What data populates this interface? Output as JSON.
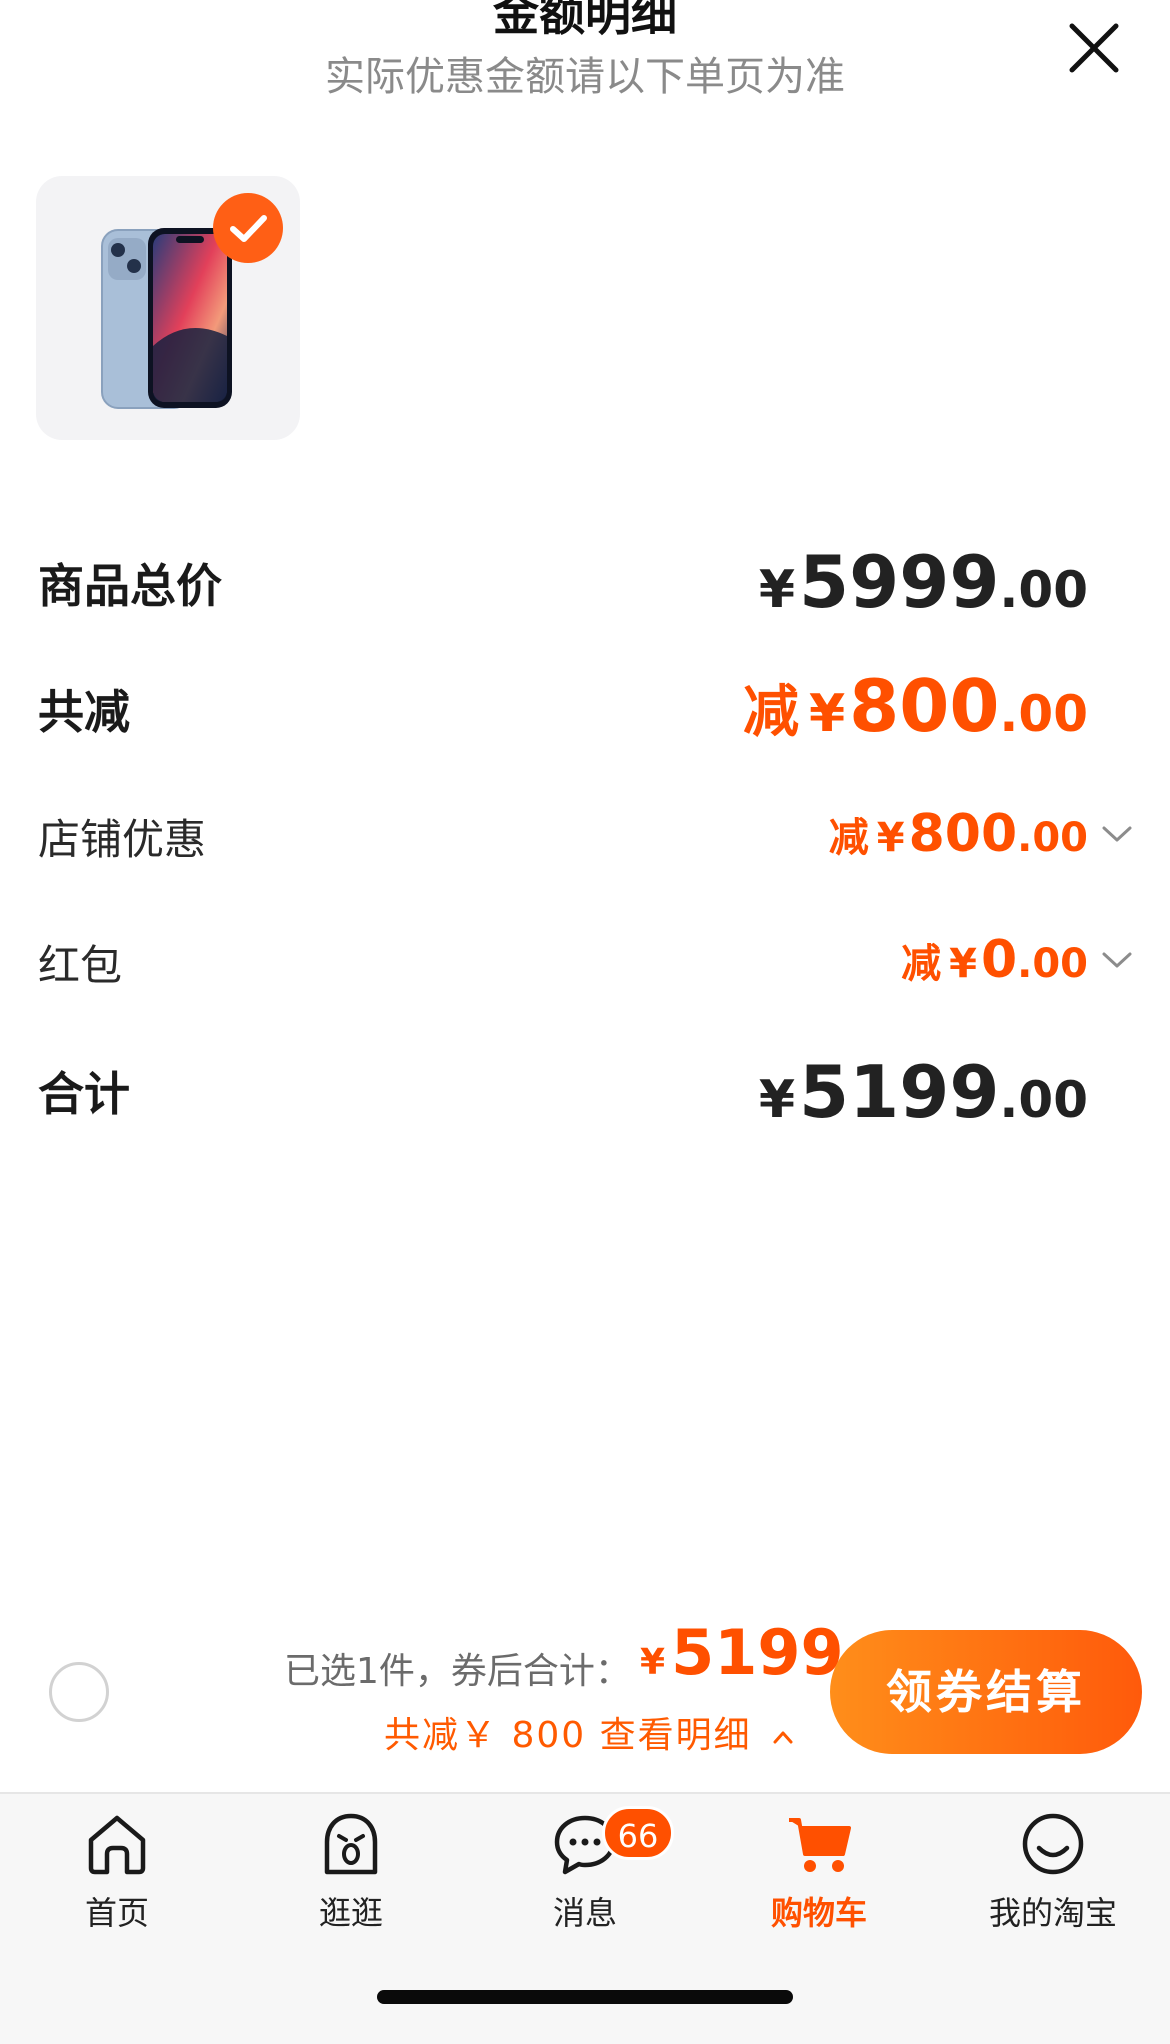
{
  "header": {
    "title": "金额明细",
    "subtitle": "实际优惠金额请以下单页为准"
  },
  "rows": {
    "total": {
      "label": "商品总价",
      "currency": "¥",
      "int": "5999",
      "dec": ".00"
    },
    "discount_total": {
      "label": "共减",
      "prefix": "减",
      "currency": "¥",
      "int": "800",
      "dec": ".00"
    },
    "shop_discount": {
      "label": "店铺优惠",
      "prefix": "减",
      "currency": "¥",
      "int": "800",
      "dec": ".00"
    },
    "red_packet": {
      "label": "红包",
      "prefix": "减",
      "currency": "¥",
      "int": "0",
      "dec": ".00"
    },
    "sum": {
      "label": "合计",
      "currency": "¥",
      "int": "5199",
      "dec": ".00"
    }
  },
  "checkout": {
    "selected_text": "已选1件，券后合计：",
    "currency": "¥",
    "price": "5199",
    "detail_link": "共减￥ 800 查看明细",
    "button_label": "领券结算"
  },
  "tabs": [
    {
      "label": "首页",
      "icon": "home-icon"
    },
    {
      "label": "逛逛",
      "icon": "browse-icon"
    },
    {
      "label": "消息",
      "icon": "message-icon",
      "badge": "66"
    },
    {
      "label": "购物车",
      "icon": "cart-icon",
      "active": true
    },
    {
      "label": "我的淘宝",
      "icon": "profile-icon"
    }
  ],
  "colors": {
    "accent": "#ff5000",
    "button_gradient_start": "#ff8e1a",
    "button_gradient_end": "#ff5a0b"
  }
}
